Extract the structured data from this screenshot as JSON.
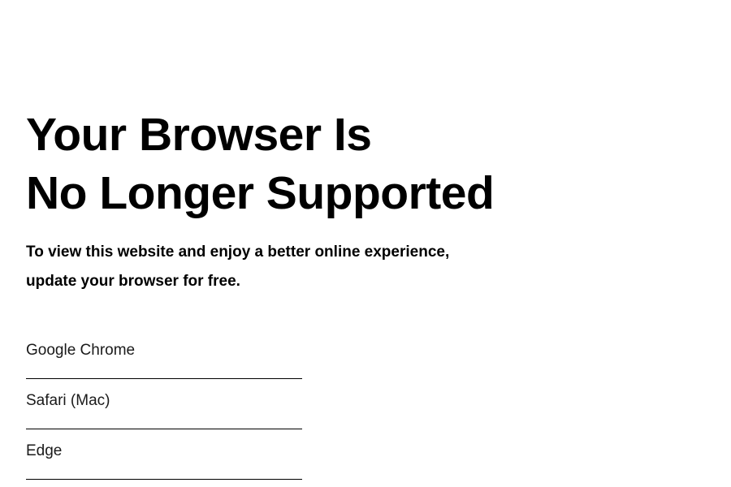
{
  "heading": {
    "line1": "Your Browser Is",
    "line2": "No Longer Supported"
  },
  "message": {
    "line1": "To view this website and enjoy a better online experience,",
    "line2": "update your browser for free."
  },
  "browsers": [
    {
      "label": "Google Chrome"
    },
    {
      "label": "Safari (Mac)"
    },
    {
      "label": "Edge"
    }
  ]
}
